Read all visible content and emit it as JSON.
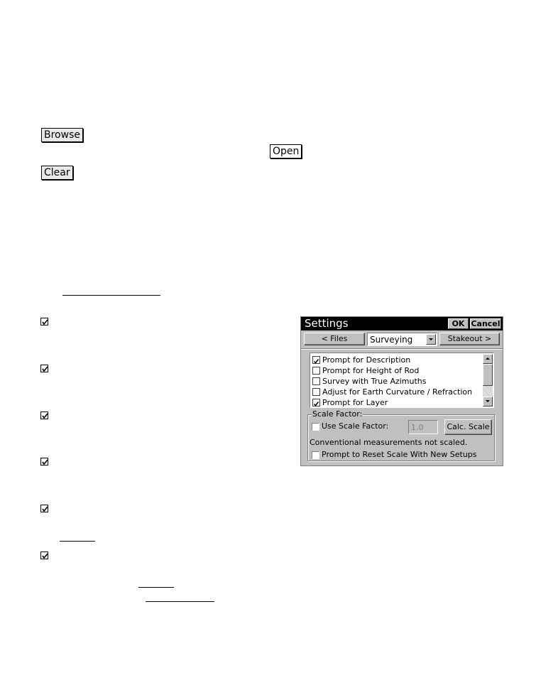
{
  "document": {
    "buttons": {
      "browse": "Browse",
      "open": "Open",
      "clear": "Clear"
    },
    "checkmark_count": 6
  },
  "dialog": {
    "title": "Settings",
    "ok_label": "OK",
    "cancel_label": "Cancel",
    "prev_label": "< Files",
    "page_select": "Surveying",
    "next_label": "Stakeout >",
    "options": [
      {
        "label": "Prompt for Description",
        "checked": true
      },
      {
        "label": "Prompt for Height of Rod",
        "checked": false
      },
      {
        "label": "Survey with True Azimuths",
        "checked": false
      },
      {
        "label": "Adjust for Earth Curvature / Refraction",
        "checked": false
      },
      {
        "label": "Prompt for Layer",
        "checked": true
      }
    ],
    "scale_group": {
      "title": "Scale Factor:",
      "use_scale_label": "Use Scale Factor:",
      "use_scale_checked": false,
      "scale_value": "1.0",
      "calc_label": "Calc. Scale",
      "status_text": "Conventional measurements not scaled.",
      "reset_label": "Prompt to Reset Scale With New Setups",
      "reset_checked": false
    }
  }
}
